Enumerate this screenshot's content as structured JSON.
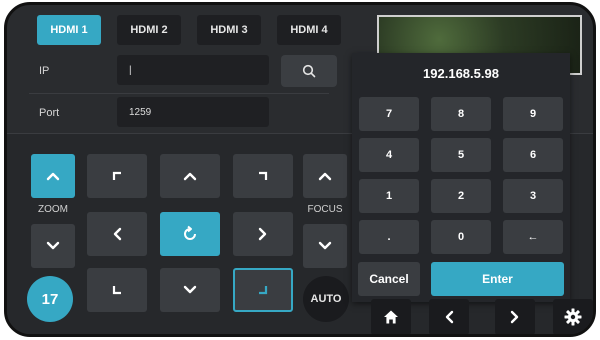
{
  "tabs": [
    {
      "label": "HDMI 1",
      "active": true
    },
    {
      "label": "HDMI 2",
      "active": false
    },
    {
      "label": "HDMI 3",
      "active": false
    },
    {
      "label": "HDMI 4",
      "active": false
    }
  ],
  "connection": {
    "ip_label": "IP",
    "ip_value": "|",
    "port_label": "Port",
    "port_value": "1259"
  },
  "zoom": {
    "label": "ZOOM"
  },
  "focus": {
    "label": "FOCUS",
    "auto_label": "AUTO"
  },
  "preset_badge": "17",
  "keypad": {
    "display": "192.168.5.98",
    "keys": [
      "7",
      "8",
      "9",
      "4",
      "5",
      "6",
      "1",
      "2",
      "3",
      ".",
      "0",
      "←"
    ],
    "cancel_label": "Cancel",
    "enter_label": "Enter"
  },
  "icons": {
    "search": "search-icon",
    "home": "home-icon",
    "back": "chevron-left-icon",
    "forward": "chevron-right-icon",
    "settings": "gear-icon",
    "reset": "refresh-icon"
  },
  "colors": {
    "accent": "#36a8c4",
    "background": "#2a2c2f",
    "button": "#3b3e42"
  }
}
